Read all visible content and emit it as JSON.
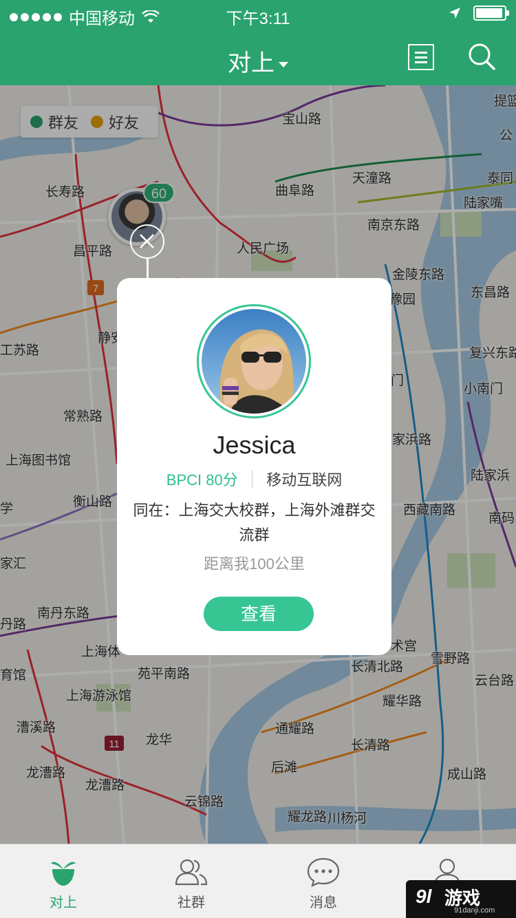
{
  "status_bar": {
    "carrier": "中国移动",
    "time": "下午3:11"
  },
  "nav": {
    "title": "对上"
  },
  "legend": {
    "items": [
      {
        "label": "群友",
        "color": "#2aa36f"
      },
      {
        "label": "好友",
        "color": "#e8a20c"
      }
    ]
  },
  "map": {
    "pin_badge": "60",
    "labels": [
      "宝山路",
      "提篮",
      "公",
      "长寿路",
      "曲阜路",
      "天潼路",
      "泰同",
      "陆家嘴",
      "昌平路",
      "人民广场",
      "南京东路",
      "金陵东路",
      "东昌路",
      "豫园",
      "工苏路",
      "静安",
      "复兴东路",
      "常熟路",
      "门",
      "小南门",
      "上海图书馆",
      "家浜路",
      "陆家浜",
      "衡山路",
      "学",
      "西藏南路",
      "南码",
      "家汇",
      "南丹东路",
      "丹路",
      "术宫",
      "雪野路",
      "上海体",
      "育馆",
      "苑平南路",
      "长清北路",
      "上海游泳馆",
      "耀华路",
      "云台路",
      "漕溪路",
      "通耀路",
      "龙华",
      "长清路",
      "后滩",
      "龙漕路",
      "成山路",
      "龙漕路",
      "云锦路",
      "耀龙路",
      "川杨河"
    ],
    "line_numbers": [
      "7",
      "11"
    ]
  },
  "card": {
    "name": "Jessica",
    "score": "BPCI 80分",
    "tag": "移动互联网",
    "groups": "同在：上海交大校群，上海外滩群交流群",
    "distance": "距离我100公里",
    "button": "查看",
    "accent": "#37c594"
  },
  "tabbar": {
    "tabs": [
      {
        "label": "对上",
        "active": true
      },
      {
        "label": "社群",
        "active": false
      },
      {
        "label": "消息",
        "active": false
      },
      {
        "label": "我",
        "active": false
      }
    ]
  },
  "watermark": {
    "logo": "9l",
    "text": "游戏",
    "site": "91danji.com"
  }
}
